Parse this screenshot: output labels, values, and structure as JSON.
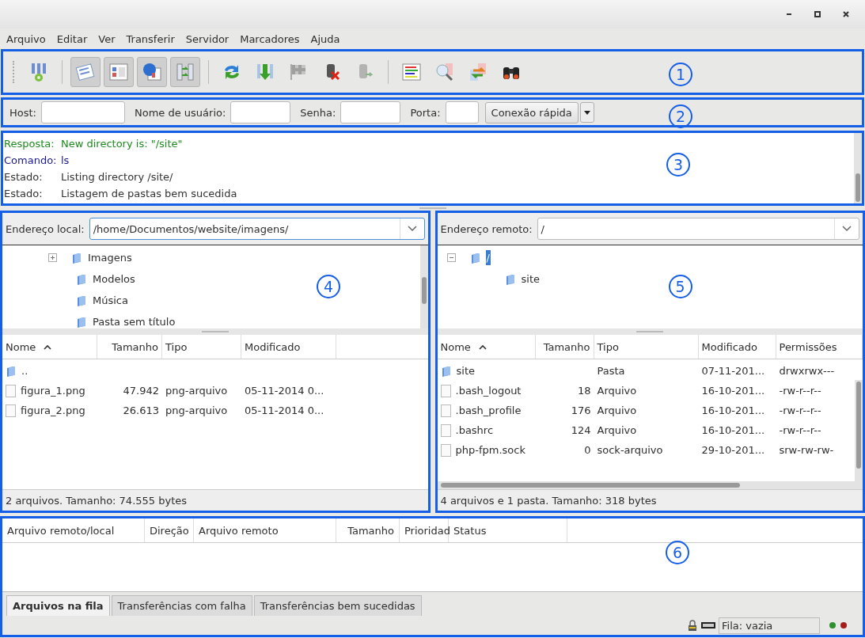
{
  "menu": [
    "Arquivo",
    "Editar",
    "Ver",
    "Transferir",
    "Servidor",
    "Marcadores",
    "Ajuda"
  ],
  "toolbar": {
    "annotation": "1",
    "groups": [
      [
        {
          "pressed": false,
          "disabled": false
        }
      ],
      [
        {
          "pressed": true,
          "disabled": false
        },
        {
          "pressed": true,
          "disabled": false
        },
        {
          "pressed": true,
          "disabled": false
        },
        {
          "pressed": true,
          "disabled": false
        }
      ],
      [
        {
          "pressed": false,
          "disabled": false
        },
        {
          "pressed": false,
          "disabled": false
        },
        {
          "pressed": false,
          "disabled": true
        },
        {
          "pressed": false,
          "disabled": false
        },
        {
          "pressed": false,
          "disabled": true
        }
      ],
      [
        {
          "pressed": false,
          "disabled": false
        },
        {
          "pressed": false,
          "disabled": false
        },
        {
          "pressed": false,
          "disabled": false
        },
        {
          "pressed": false,
          "disabled": false
        }
      ]
    ]
  },
  "quickconnect": {
    "annotation": "2",
    "fields": [
      {
        "label": "Host:"
      },
      {
        "label": "Nome de usuário:"
      },
      {
        "label": "Senha:"
      },
      {
        "label": "Porta:"
      }
    ],
    "button": "Conexão rápida"
  },
  "log": {
    "annotation": "3",
    "lines": [
      {
        "kind": "response",
        "label": "Resposta:",
        "text": "New directory is: \"/site\""
      },
      {
        "kind": "command",
        "label": "Comando:",
        "text": "ls"
      },
      {
        "kind": "status",
        "label": "Estado:",
        "text": "Listing directory /site/"
      },
      {
        "kind": "status",
        "label": "Estado:",
        "text": "Listagem de pastas bem sucedida"
      }
    ]
  },
  "local": {
    "annotation": "4",
    "address_label": "Endereço local:",
    "address": "/home/Documentos/website/imagens/",
    "tree": [
      {
        "name": "Imagens",
        "expanded": false,
        "selected": false
      },
      {
        "name": "Modelos",
        "selected": false
      },
      {
        "name": "Música",
        "selected": false
      },
      {
        "name": "Pasta sem título",
        "selected": false
      }
    ],
    "columns": [
      {
        "label": "Nome",
        "sorted": true
      },
      {
        "label": "Tamanho",
        "sorted": false
      },
      {
        "label": "Tipo",
        "sorted": false
      },
      {
        "label": "Modificado",
        "sorted": false
      }
    ],
    "rows": [
      {
        "kind": "folder",
        "name": ".."
      },
      {
        "kind": "file",
        "name": "figura_1.png",
        "size": "47.942",
        "type": "png-arquivo",
        "modified": "05-11-2014 0..."
      },
      {
        "kind": "file",
        "name": "figura_2.png",
        "size": "26.613",
        "type": "png-arquivo",
        "modified": "05-11-2014 0..."
      }
    ],
    "summary": "2 arquivos. Tamanho: 74.555 bytes"
  },
  "remote": {
    "annotation": "5",
    "address_label": "Endereço remoto:",
    "address": "/",
    "tree": [
      {
        "name": "/",
        "expanded": true,
        "selected": true,
        "children": [
          {
            "name": "site",
            "selected": false
          }
        ]
      }
    ],
    "columns": [
      {
        "label": "Nome",
        "sorted": true
      },
      {
        "label": "Tamanho",
        "sorted": false
      },
      {
        "label": "Tipo",
        "sorted": false
      },
      {
        "label": "Modificado",
        "sorted": false
      },
      {
        "label": "Permissões",
        "sorted": false
      }
    ],
    "rows": [
      {
        "kind": "folder",
        "name": "site",
        "type": "Pasta",
        "modified": "07-11-201...",
        "permissions": "drwxrwx---"
      },
      {
        "kind": "file",
        "name": ".bash_logout",
        "size": "18",
        "type": "Arquivo",
        "modified": "16-10-201...",
        "permissions": "-rw-r--r--"
      },
      {
        "kind": "file",
        "name": ".bash_profile",
        "size": "176",
        "type": "Arquivo",
        "modified": "16-10-201...",
        "permissions": "-rw-r--r--"
      },
      {
        "kind": "file",
        "name": ".bashrc",
        "size": "124",
        "type": "Arquivo",
        "modified": "16-10-201...",
        "permissions": "-rw-r--r--"
      },
      {
        "kind": "file",
        "name": "php-fpm.sock",
        "size": "0",
        "type": "sock-arquivo",
        "modified": "29-10-201...",
        "permissions": "srw-rw-rw-"
      }
    ],
    "summary": "4 arquivos e 1 pasta. Tamanho: 318 bytes"
  },
  "queue": {
    "annotation": "6",
    "columns": [
      "Arquivo remoto/local",
      "Direção",
      "Arquivo remoto",
      "Tamanho",
      "Prioridad",
      "Status"
    ],
    "tabs": [
      {
        "label": "Arquivos na fila",
        "selected": true
      },
      {
        "label": "Transferências com falha",
        "selected": false
      },
      {
        "label": "Transferências bem sucedidas",
        "selected": false
      }
    ],
    "status": "Fila: vazia",
    "lights": [
      {
        "color": "#2f8f2f"
      },
      {
        "color": "#a31d1d"
      }
    ]
  }
}
